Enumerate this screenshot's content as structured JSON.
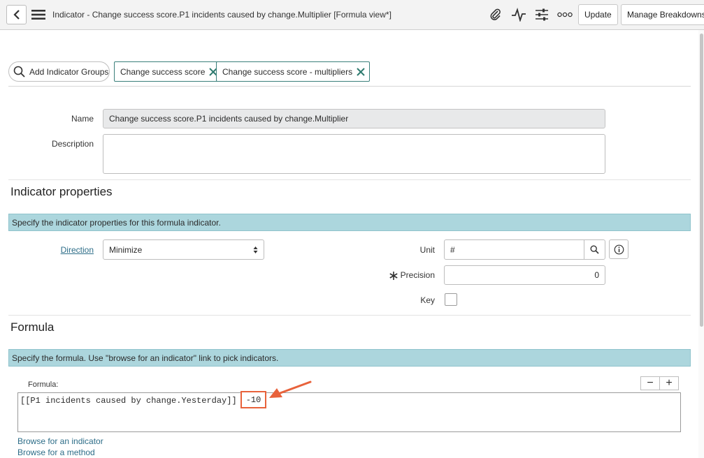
{
  "header": {
    "title": "Indicator - Change success score.P1 incidents caused by change.Multiplier [Formula view*]",
    "update_label": "Update",
    "manage_breakdowns_label": "Manage Breakdowns",
    "icons": [
      "back-icon",
      "menu-icon",
      "paperclip-icon",
      "activity-icon",
      "settings-sliders-icon",
      "more-icon"
    ]
  },
  "groups": {
    "add_label": "Add Indicator Groups",
    "tags": [
      {
        "label": "Change success score"
      },
      {
        "label": "Change success score - multipliers"
      }
    ]
  },
  "form": {
    "name_label": "Name",
    "name_value": "Change success score.P1 incidents caused by change.Multiplier",
    "description_label": "Description",
    "description_value": ""
  },
  "indicator_properties": {
    "title": "Indicator properties",
    "info": "Specify the indicator properties for this formula indicator.",
    "direction_label": "Direction",
    "direction_value": "Minimize",
    "unit_label": "Unit",
    "unit_value": "#",
    "precision_label": "Precision",
    "precision_value": "0",
    "key_label": "Key",
    "key_checked": false
  },
  "formula_section": {
    "title": "Formula",
    "info": "Specify the formula. Use \"browse for an indicator\" link to pick indicators.",
    "formula_label": "Formula:",
    "formula_main": "[[P1 incidents caused by change.Yesterday]] *",
    "formula_highlight": "-10",
    "zoom_out": "−",
    "zoom_in": "+",
    "browse_indicator": "Browse for an indicator",
    "browse_method": "Browse for a method"
  },
  "colors": {
    "info_bar": "#acd6dd",
    "tag_border": "#3a7f7a",
    "annotation": "#e8623b",
    "link": "#2d6d88"
  }
}
